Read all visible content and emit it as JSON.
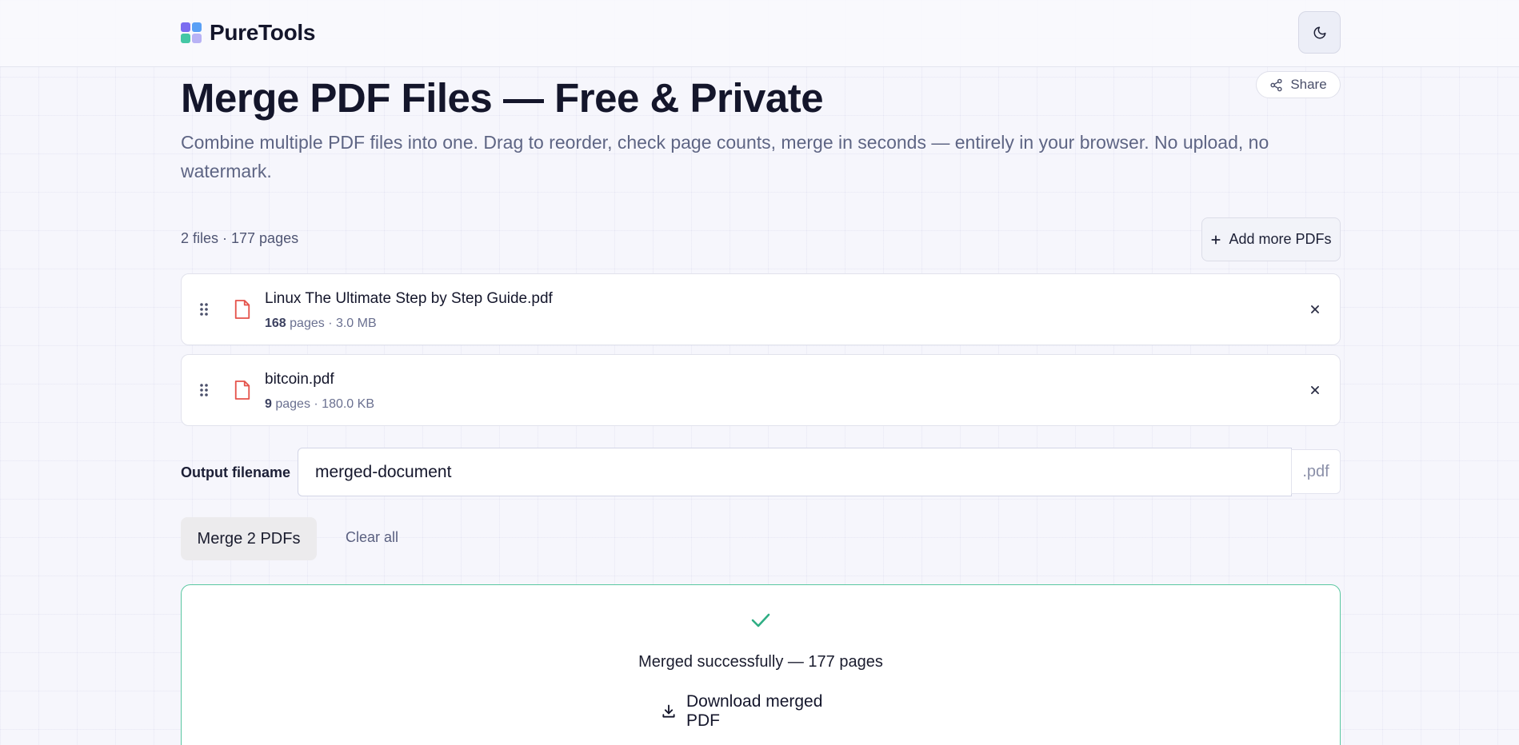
{
  "header": {
    "brand_name": "PureTools",
    "theme_toggle_icon": "moon-icon",
    "logo_colors": [
      "#7b6cf0",
      "#5aa0f5",
      "#44c7a5",
      "#b8b2f5"
    ]
  },
  "page": {
    "title": "Merge PDF Files — Free & Private",
    "subtitle": "Combine multiple PDF files into one. Drag to reorder, check page counts, merge in seconds — entirely in your browser. No upload, no watermark.",
    "share_label": "Share"
  },
  "files_summary": "2 files · 177 pages",
  "add_more_label": "Add more PDFs",
  "files": [
    {
      "name": "Linux The Ultimate Step by Step Guide.pdf",
      "pages": "168",
      "pages_suffix": " pages · 3.0 MB"
    },
    {
      "name": "bitcoin.pdf",
      "pages": "9",
      "pages_suffix": " pages · 180.0 KB"
    }
  ],
  "output": {
    "label": "Output filename",
    "value": "merged-document",
    "extension": ".pdf"
  },
  "actions": {
    "merge_label": "Merge 2 PDFs",
    "clear_label": "Clear all"
  },
  "result": {
    "message": "Merged successfully — 177 pages",
    "download_label": "Download merged PDF"
  },
  "colors": {
    "accent_success": "#2fae84",
    "file_icon": "#e5534b",
    "text_primary": "#14162b"
  }
}
